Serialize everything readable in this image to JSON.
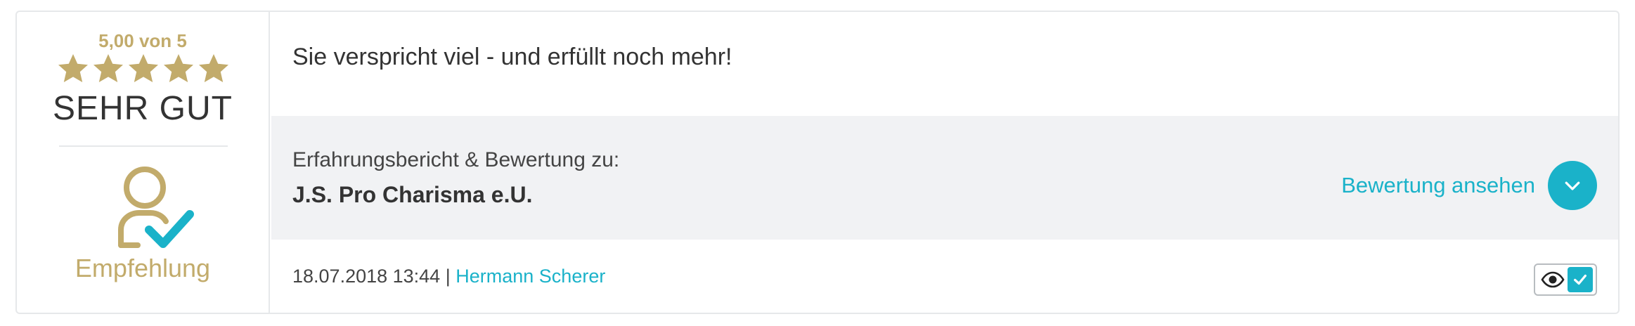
{
  "rating": {
    "score_text": "5,00 von 5",
    "stars": 5,
    "max_stars": 5,
    "label": "SEHR GUT",
    "recommendation_label": "Empfehlung"
  },
  "review": {
    "title": "Sie verspricht viel - und erfüllt noch mehr!",
    "subject_intro": "Erfahrungsbericht & Bewertung zu:",
    "subject_name": "J.S. Pro Charisma e.U.",
    "view_link_label": "Bewertung ansehen",
    "datetime": "18.07.2018 13:44",
    "separator": "|",
    "author": "Hermann Scherer"
  },
  "colors": {
    "gold": "#c2ab6b",
    "accent": "#1ab2c9",
    "panel_bg": "#f1f2f4",
    "border": "#e6e8ea"
  },
  "icons": {
    "star": "star-icon",
    "recommendation": "user-check-icon",
    "expand": "chevron-down-icon",
    "badge_eye": "eye-icon",
    "badge_check": "check-icon"
  }
}
